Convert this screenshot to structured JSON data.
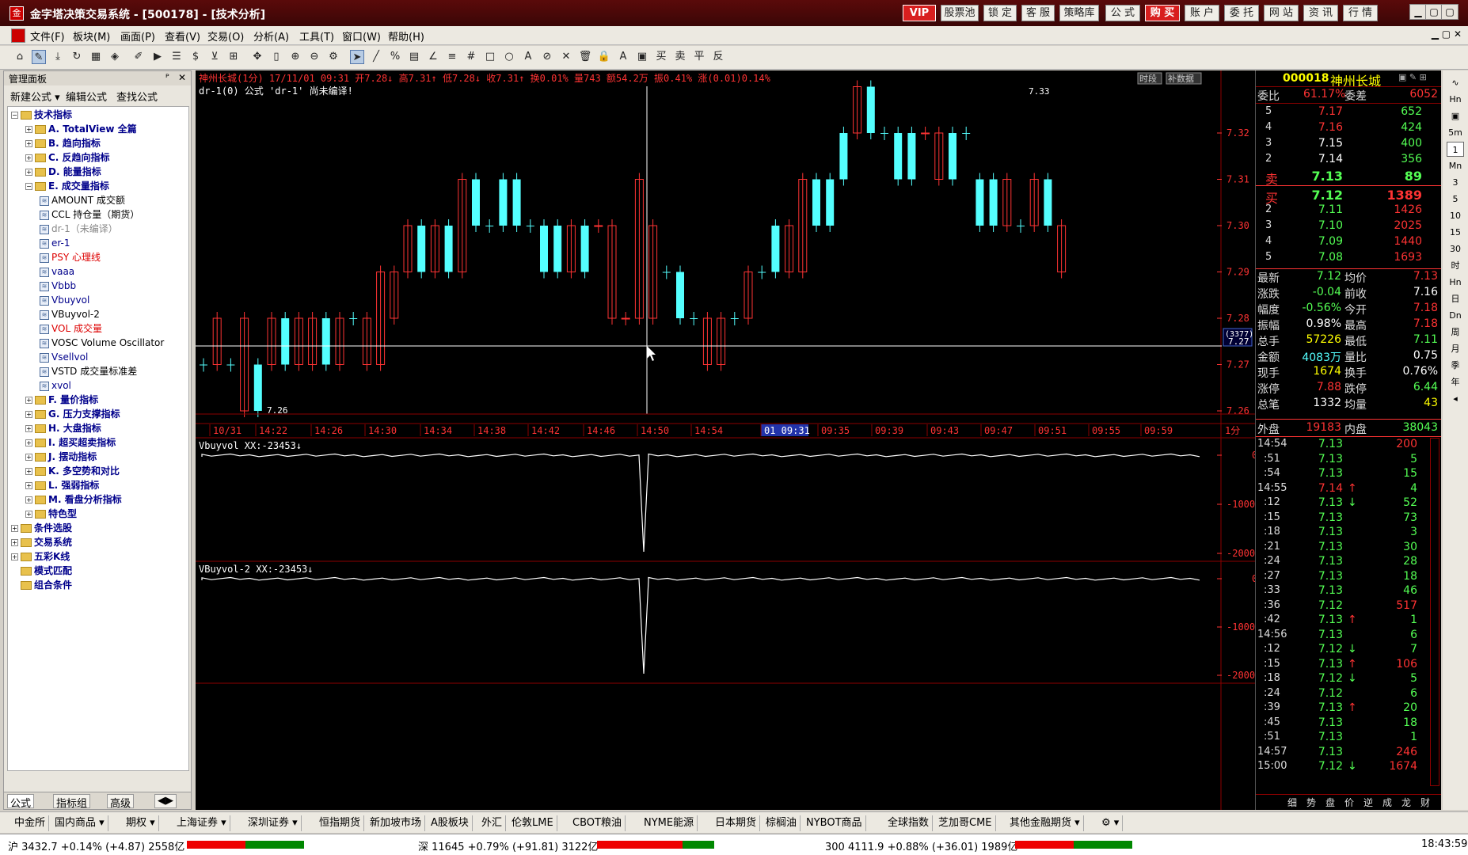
{
  "titlebar": {
    "title": "金字塔决策交易系统 - [500178] - [技术分析]",
    "logo": "金",
    "buttons": [
      "VIP",
      "股票池",
      "锁 定",
      "客 服",
      "策略库",
      "公 式",
      "购 买",
      "账 户",
      "委 托",
      "网 站",
      "资 讯",
      "行 情"
    ],
    "win": [
      "▁",
      "▢",
      "▢",
      "✕"
    ]
  },
  "menubar": {
    "items": [
      "文件(F)",
      "板块(M)",
      "画面(P)",
      "查看(V)",
      "交易(O)",
      "分析(A)",
      "工具(T)",
      "窗口(W)",
      "帮助(H)"
    ]
  },
  "leftpanel": {
    "header": "管理面板",
    "pin": "ᴾ",
    "close": "✕",
    "menu": [
      "新建公式 ▾",
      "编辑公式",
      "查找公式"
    ],
    "tree": [
      {
        "t": "技术指标",
        "lvl": 0,
        "kind": "folder",
        "pm": "−",
        "cls": "blue"
      },
      {
        "t": "A. TotalView 全篇",
        "lvl": 1,
        "kind": "folder",
        "pm": "+",
        "cls": "blue"
      },
      {
        "t": "B. 趋向指标",
        "lvl": 1,
        "kind": "folder",
        "pm": "+",
        "cls": "blue"
      },
      {
        "t": "C. 反趋向指标",
        "lvl": 1,
        "kind": "folder",
        "pm": "+",
        "cls": "blue"
      },
      {
        "t": "D. 能量指标",
        "lvl": 1,
        "kind": "folder",
        "pm": "+",
        "cls": "blue"
      },
      {
        "t": "E. 成交量指标",
        "lvl": 1,
        "kind": "folder",
        "pm": "−",
        "cls": "blue"
      },
      {
        "t": "AMOUNT 成交额",
        "lvl": 2,
        "kind": "file",
        "color": "#000"
      },
      {
        "t": "CCL 持仓量（期货）",
        "lvl": 2,
        "kind": "file",
        "color": "#000"
      },
      {
        "t": "dr-1（未编译）",
        "lvl": 2,
        "kind": "file",
        "color": "#888"
      },
      {
        "t": "er-1",
        "lvl": 2,
        "kind": "file",
        "color": "#00008b"
      },
      {
        "t": "PSY 心理线",
        "lvl": 2,
        "kind": "file",
        "color": "#d00"
      },
      {
        "t": "vaaa",
        "lvl": 2,
        "kind": "file",
        "color": "#00008b"
      },
      {
        "t": "Vbbb",
        "lvl": 2,
        "kind": "file",
        "color": "#00008b"
      },
      {
        "t": "Vbuyvol",
        "lvl": 2,
        "kind": "file",
        "color": "#00008b"
      },
      {
        "t": "VBuyvol-2",
        "lvl": 2,
        "kind": "file",
        "color": "#000"
      },
      {
        "t": "VOL 成交量",
        "lvl": 2,
        "kind": "file",
        "color": "#d00"
      },
      {
        "t": "VOSC Volume Oscillator",
        "lvl": 2,
        "kind": "file",
        "color": "#000"
      },
      {
        "t": "Vsellvol",
        "lvl": 2,
        "kind": "file",
        "color": "#00008b"
      },
      {
        "t": "VSTD 成交量标准差",
        "lvl": 2,
        "kind": "file",
        "color": "#000"
      },
      {
        "t": "xvol",
        "lvl": 2,
        "kind": "file",
        "color": "#00008b"
      },
      {
        "t": "F. 量价指标",
        "lvl": 1,
        "kind": "folder",
        "pm": "+",
        "cls": "blue"
      },
      {
        "t": "G. 压力支撑指标",
        "lvl": 1,
        "kind": "folder",
        "pm": "+",
        "cls": "blue"
      },
      {
        "t": "H. 大盘指标",
        "lvl": 1,
        "kind": "folder",
        "pm": "+",
        "cls": "blue"
      },
      {
        "t": "I. 超买超卖指标",
        "lvl": 1,
        "kind": "folder",
        "pm": "+",
        "cls": "blue"
      },
      {
        "t": "J. 摆动指标",
        "lvl": 1,
        "kind": "folder",
        "pm": "+",
        "cls": "blue"
      },
      {
        "t": "K. 多空势和对比",
        "lvl": 1,
        "kind": "folder",
        "pm": "+",
        "cls": "blue"
      },
      {
        "t": "L. 强弱指标",
        "lvl": 1,
        "kind": "folder",
        "pm": "+",
        "cls": "blue"
      },
      {
        "t": "M. 看盘分析指标",
        "lvl": 1,
        "kind": "folder",
        "pm": "+",
        "cls": "blue"
      },
      {
        "t": "特色型",
        "lvl": 1,
        "kind": "folder",
        "pm": "+",
        "cls": "blue"
      },
      {
        "t": "条件选股",
        "lvl": 0,
        "kind": "folder",
        "pm": "+",
        "cls": "blue"
      },
      {
        "t": "交易系统",
        "lvl": 0,
        "kind": "folder",
        "pm": "+",
        "cls": "blue"
      },
      {
        "t": "五彩K线",
        "lvl": 0,
        "kind": "folder",
        "pm": "+",
        "cls": "blue"
      },
      {
        "t": "模式匹配",
        "lvl": 0,
        "kind": "folder",
        "pm": "",
        "cls": "blue"
      },
      {
        "t": "组合条件",
        "lvl": 0,
        "kind": "folder",
        "pm": "",
        "cls": "blue"
      }
    ],
    "tabs": [
      "公式",
      "指标组",
      "高级",
      "◀▶"
    ]
  },
  "chart": {
    "header": "神州长城(1分) 17/11/01 09:31 开7.28↓ 高7.31↑ 低7.28↓ 收7.31↑ 换0.01% 量743 额54.2万 振0.41% 涨(0.01)0.14%",
    "status": "dr-1(0)   公式 'dr-1' 尚未编译!",
    "badges": [
      "时段",
      "补数据"
    ],
    "cursor_price": "7.27",
    "cursor_tag": "(3377)",
    "high_label": "7.33",
    "low_label": "7.26",
    "time_axis": [
      "10/31",
      "14:22",
      "14:26",
      "14:30",
      "14:34",
      "14:38",
      "14:42",
      "14:46",
      "14:50",
      "14:54",
      "01 09:31",
      "09:35",
      "09:39",
      "09:43",
      "09:47",
      "09:51",
      "09:55",
      "09:59"
    ],
    "period": "1分",
    "price_ticks": [
      "7.32",
      "7.31",
      "7.30",
      "7.29",
      "7.28",
      "7.27",
      "7.26"
    ],
    "panel1": {
      "title": "Vbuyvol XX:-23453↓",
      "ticks": [
        "0",
        "-10000",
        "-20000"
      ]
    },
    "panel2": {
      "title": "VBuyvol-2 XX:-23453↓",
      "ticks": [
        "0",
        "-10000",
        "-20000"
      ]
    }
  },
  "quote": {
    "code": "000018",
    "name": "神州长城",
    "wb": {
      "l1": "委比",
      "v1": "61.17%",
      "l2": "委差",
      "v2": "6052"
    },
    "sell": [
      [
        "5",
        "7.17",
        "652"
      ],
      [
        "4",
        "7.16",
        "424"
      ],
      [
        "3",
        "7.15",
        "400"
      ],
      [
        "2",
        "7.14",
        "356"
      ],
      [
        "卖",
        "7.13",
        "89"
      ]
    ],
    "buy": [
      [
        "买",
        "7.12",
        "1389"
      ],
      [
        "2",
        "7.11",
        "1426"
      ],
      [
        "3",
        "7.10",
        "2025"
      ],
      [
        "4",
        "7.09",
        "1440"
      ],
      [
        "5",
        "7.08",
        "1693"
      ]
    ],
    "stats": [
      [
        "最新",
        "7.12",
        "均价",
        "7.13"
      ],
      [
        "涨跌",
        "-0.04",
        "前收",
        "7.16"
      ],
      [
        "幅度",
        "-0.56%",
        "今开",
        "7.18"
      ],
      [
        "振幅",
        "0.98%",
        "最高",
        "7.18"
      ],
      [
        "总手",
        "57226",
        "最低",
        "7.11"
      ],
      [
        "金额",
        "4083万",
        "量比",
        "0.75"
      ],
      [
        "现手",
        "1674",
        "换手",
        "0.76%"
      ],
      [
        "涨停",
        "7.88",
        "跌停",
        "6.44"
      ],
      [
        "总笔",
        "1332",
        "均量",
        "43"
      ]
    ],
    "outer": {
      "l1": "外盘",
      "v1": "19183",
      "l2": "内盘",
      "v2": "38043"
    },
    "ticks": [
      [
        "14:54",
        "7.13",
        "",
        "200"
      ],
      [
        ":51",
        "7.13",
        "",
        "5"
      ],
      [
        ":54",
        "7.13",
        "",
        "15"
      ],
      [
        "14:55",
        "7.14",
        "↑",
        "4"
      ],
      [
        ":12",
        "7.13",
        "↓",
        "52"
      ],
      [
        ":15",
        "7.13",
        "",
        "73"
      ],
      [
        ":18",
        "7.13",
        "",
        "3"
      ],
      [
        ":21",
        "7.13",
        "",
        "30"
      ],
      [
        ":24",
        "7.13",
        "",
        "28"
      ],
      [
        ":27",
        "7.13",
        "",
        "18"
      ],
      [
        ":33",
        "7.13",
        "",
        "46"
      ],
      [
        ":36",
        "7.12",
        "",
        "517"
      ],
      [
        ":42",
        "7.13",
        "↑",
        "1"
      ],
      [
        "14:56",
        "7.13",
        "",
        "6"
      ],
      [
        ":12",
        "7.12",
        "↓",
        "7"
      ],
      [
        ":15",
        "7.13",
        "↑",
        "106"
      ],
      [
        ":18",
        "7.12",
        "↓",
        "5"
      ],
      [
        ":24",
        "7.12",
        "",
        "6"
      ],
      [
        ":39",
        "7.13",
        "↑",
        "20"
      ],
      [
        ":45",
        "7.13",
        "",
        "18"
      ],
      [
        ":51",
        "7.13",
        "",
        "1"
      ],
      [
        "14:57",
        "7.13",
        "",
        "246"
      ],
      [
        "15:00",
        "7.12",
        "↓",
        "1674"
      ]
    ],
    "bottom_tabs": [
      "细",
      "势",
      "盘",
      "价",
      "逆",
      "成",
      "龙",
      "财"
    ]
  },
  "rightstrip": [
    "∿",
    "Hn",
    "▣",
    "5m",
    "1",
    "Mn",
    "3",
    "5",
    "10",
    "15",
    "30",
    "时",
    "Hn",
    "日",
    "Dn",
    "周",
    "月",
    "季",
    "年",
    "◂"
  ],
  "bottombar": [
    "中金所",
    "国内商品 ▾",
    "期权 ▾",
    "上海证券 ▾",
    "深圳证券 ▾",
    "恒指期货",
    "新加坡市场",
    "A股板块",
    "外汇",
    "伦敦LME",
    "CBOT粮油",
    "NYME能源",
    "日本期货",
    "棕榈油",
    "NYBOT商品",
    "全球指数",
    "芝加哥CME",
    "其他金融期货 ▾",
    "⚙ ▾"
  ],
  "statusbar": {
    "sh": "沪 3432.7 +0.14% (+4.87) 2558亿",
    "sz": "深 11645 +0.79% (+91.81) 3122亿",
    "c300": "300 4111.9 +0.88% (+36.01) 1989亿",
    "clock": "18:43:59"
  },
  "colors": {
    "up": "#ff3333",
    "down": "#54ffff",
    "bg": "#000000",
    "grid": "#8b0000",
    "yellow": "#ffff00"
  }
}
